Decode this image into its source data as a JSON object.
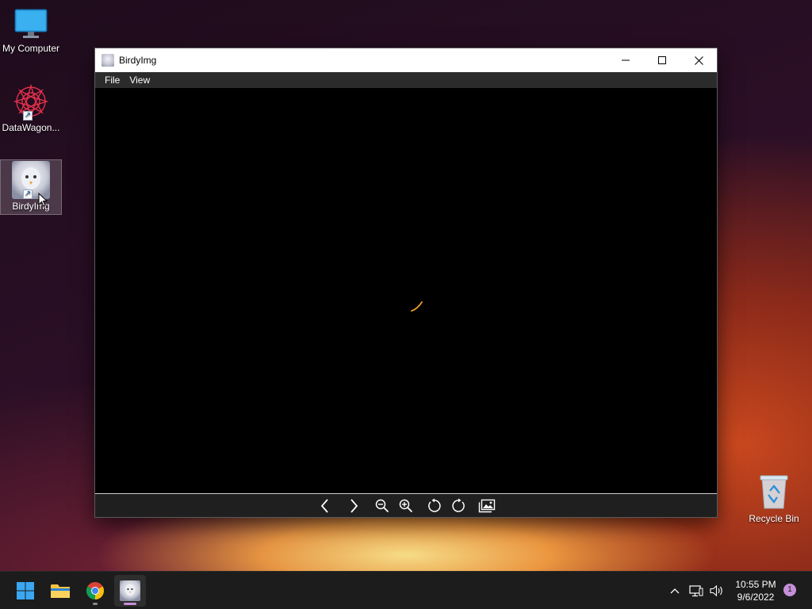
{
  "desktop": {
    "icons": [
      {
        "label": "My Computer",
        "icon": "monitor-icon"
      },
      {
        "label": "DataWagon...",
        "icon": "datawagon-icon"
      },
      {
        "label": "BirdyImg",
        "icon": "birdyimg-icon"
      },
      {
        "label": "Recycle Bin",
        "icon": "recycle-bin-icon"
      }
    ]
  },
  "window": {
    "title": "BirdyImg",
    "menu": [
      {
        "label": "File"
      },
      {
        "label": "View"
      }
    ],
    "toolbar": [
      "previous-icon",
      "next-icon",
      "zoom-out-icon",
      "zoom-in-icon",
      "rotate-left-icon",
      "rotate-right-icon",
      "gallery-icon"
    ],
    "spinner_color": "#f0a020"
  },
  "taskbar": {
    "apps": [
      "start-icon",
      "file-explorer-icon",
      "chrome-icon",
      "birdyimg-icon"
    ],
    "time": "10:55 PM",
    "date": "9/6/2022",
    "notifications": "1"
  },
  "colors": {
    "accent": "#c78fd9",
    "taskbar": "#1c1c1c",
    "menubar": "#2b2b2b"
  }
}
